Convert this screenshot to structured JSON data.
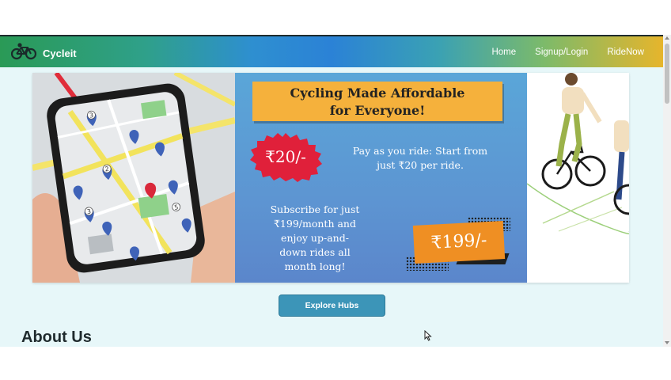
{
  "brand": {
    "name": "Cycleit",
    "icon": "bicycle-icon"
  },
  "nav": {
    "items": [
      {
        "label": "Home"
      },
      {
        "label": "Signup/Login"
      },
      {
        "label": "RideNow"
      }
    ]
  },
  "hero": {
    "headline_line1": "Cycling Made Affordable",
    "headline_line2": "for Everyone!",
    "price_badge": "₹20/-",
    "pay_line1": "Pay as you ride: Start from",
    "pay_line2": "just ₹20 per ride.",
    "sub_line1": "Subscribe for just",
    "sub_line2": "₹199/month and",
    "sub_line3": "enjoy up-and-",
    "sub_line4": "down rides all",
    "sub_line5": "month long!",
    "subscription_badge": "₹199/-",
    "map_pins": [
      "3",
      "2",
      "3",
      "5"
    ]
  },
  "explore_button": {
    "label": "Explore Hubs"
  },
  "about": {
    "title": "About Us"
  },
  "colors": {
    "orange": "#f5b13c",
    "badge_red": "#e0203a",
    "button": "#3c95b8",
    "bg": "#e7f7f9"
  }
}
